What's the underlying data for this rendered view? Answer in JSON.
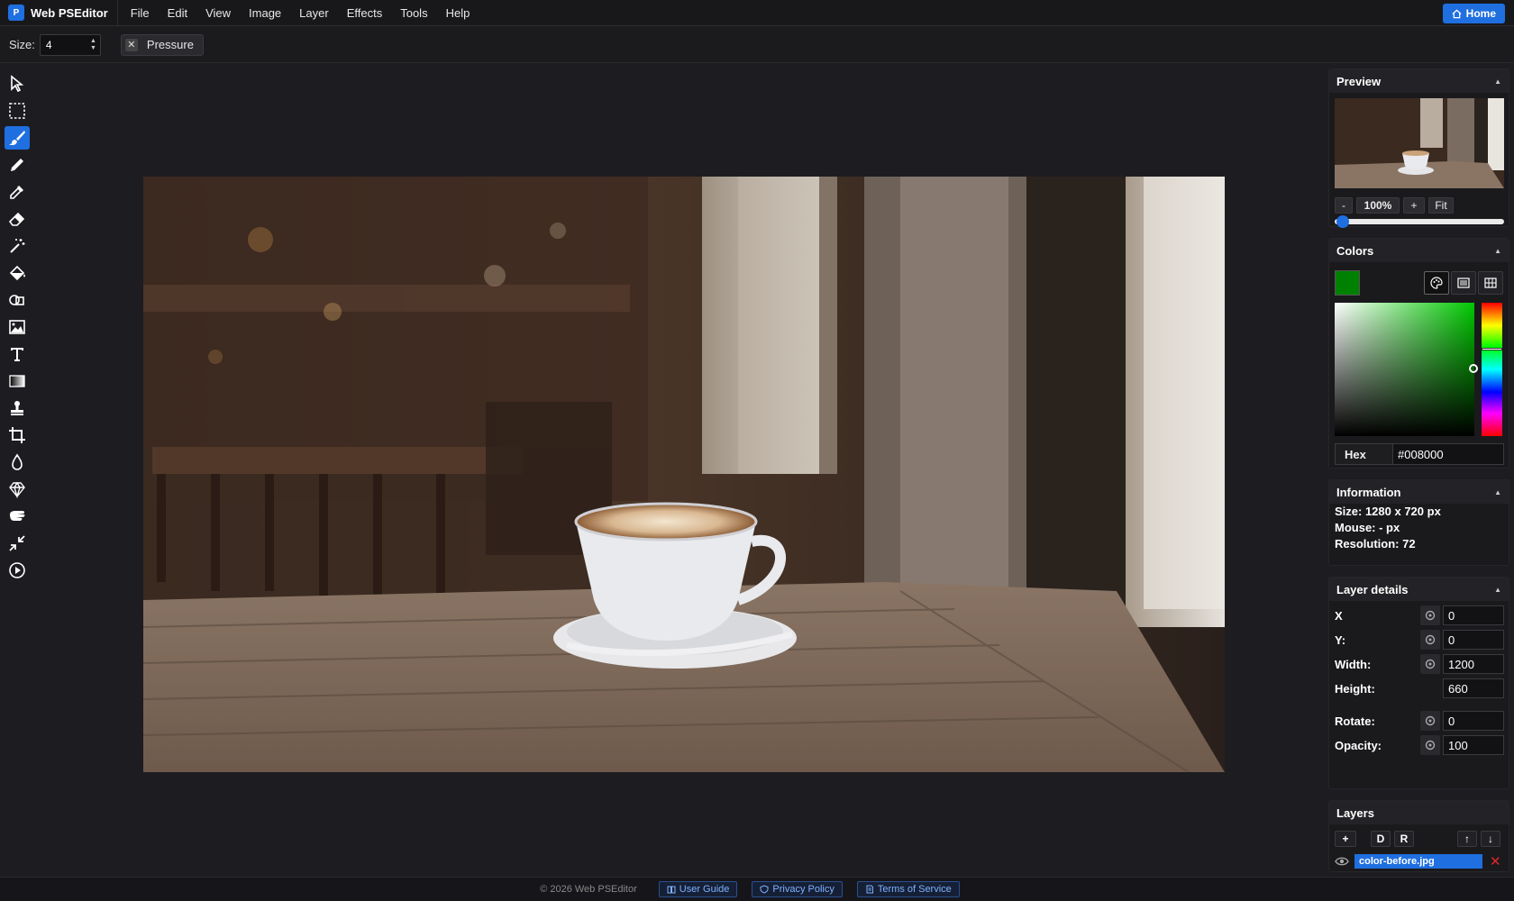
{
  "app": {
    "name": "Web PSEditor",
    "logo_letter": "P"
  },
  "menu": [
    "File",
    "Edit",
    "View",
    "Image",
    "Layer",
    "Effects",
    "Tools",
    "Help"
  ],
  "home_label": "Home",
  "options": {
    "size_label": "Size:",
    "size_value": "4",
    "pressure_label": "Pressure"
  },
  "tools": [
    {
      "name": "select-icon"
    },
    {
      "name": "marquee-icon"
    },
    {
      "name": "brush-icon",
      "active": true
    },
    {
      "name": "pencil-icon"
    },
    {
      "name": "eyedropper-icon"
    },
    {
      "name": "eraser-icon"
    },
    {
      "name": "magic-wand-icon"
    },
    {
      "name": "fill-bucket-icon"
    },
    {
      "name": "shapes-icon"
    },
    {
      "name": "image-icon"
    },
    {
      "name": "text-icon"
    },
    {
      "name": "gradient-icon"
    },
    {
      "name": "stamp-icon"
    },
    {
      "name": "crop-icon"
    },
    {
      "name": "blur-icon"
    },
    {
      "name": "sharpen-icon"
    },
    {
      "name": "smudge-icon"
    },
    {
      "name": "resize-icon"
    },
    {
      "name": "play-icon"
    }
  ],
  "preview": {
    "title": "Preview",
    "zoom_minus": "-",
    "zoom_value": "100%",
    "zoom_plus": "+",
    "zoom_fit": "Fit",
    "zoom_level": 0.0
  },
  "colors": {
    "title": "Colors",
    "current": "#008000",
    "hex_label": "Hex",
    "hex_value": "#008000"
  },
  "information": {
    "title": "Information",
    "size": "Size: 1280 x 720 px",
    "mouse": "Mouse: - px",
    "resolution": "Resolution: 72"
  },
  "layer_details": {
    "title": "Layer details",
    "x_label": "X",
    "x_value": "0",
    "y_label": "Y:",
    "y_value": "0",
    "width_label": "Width:",
    "width_value": "1200",
    "height_label": "Height:",
    "height_value": "660",
    "rotate_label": "Rotate:",
    "rotate_value": "0",
    "opacity_label": "Opacity:",
    "opacity_value": "100"
  },
  "layers": {
    "title": "Layers",
    "add": "+",
    "dup": "D",
    "rename": "R",
    "up": "↑",
    "down": "↓",
    "items": [
      {
        "name": "color-before.jpg",
        "visible": true
      }
    ]
  },
  "footer": {
    "copyright": "© 2026 Web PSEditor",
    "links": [
      "User Guide",
      "Privacy Policy",
      "Terms of Service"
    ]
  },
  "theme": {
    "accent": "#1f6fe0",
    "delete": "#e0262b"
  }
}
